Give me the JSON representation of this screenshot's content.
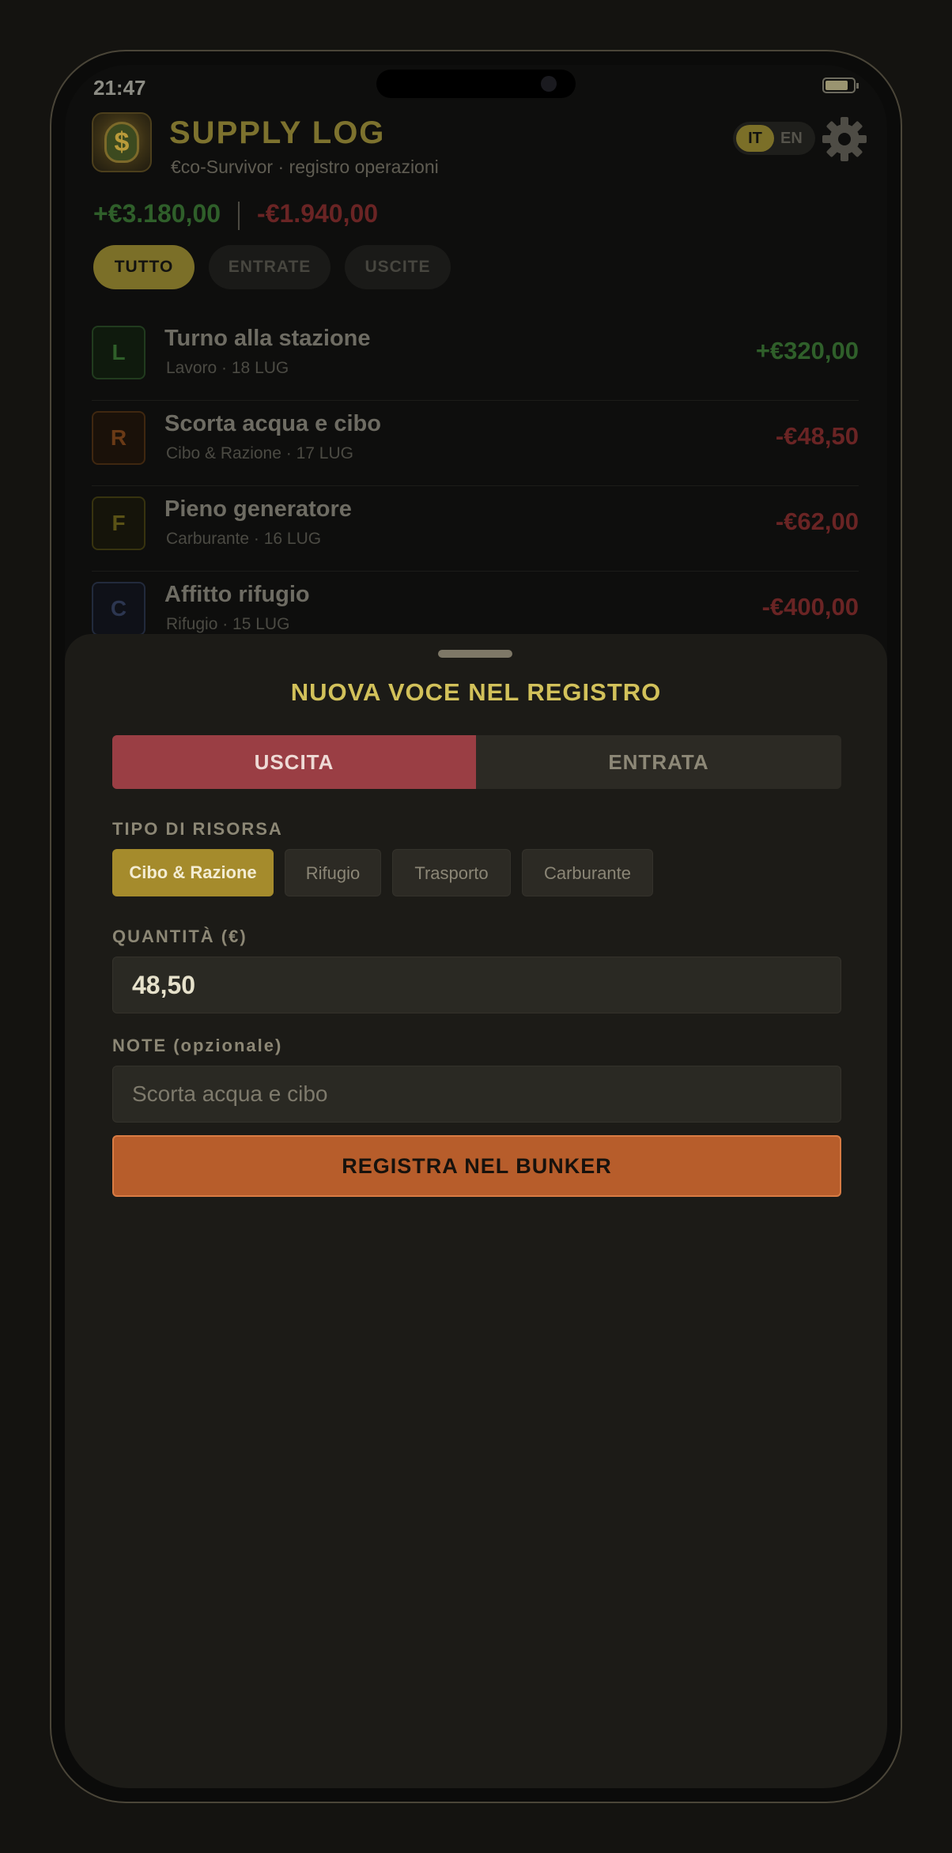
{
  "status_bar": {
    "time": "21:47"
  },
  "header": {
    "title": "SUPPLY LOG",
    "subtitle": "€co-Survivor · registro operazioni",
    "lang_active": "IT",
    "lang_other": "EN",
    "icon_glyph": "$"
  },
  "totals": {
    "income": "+€3.180,00",
    "expense": "-€1.940,00"
  },
  "filters": [
    {
      "label": "TUTTO",
      "active": true
    },
    {
      "label": "ENTRATE",
      "active": false
    },
    {
      "label": "USCITE",
      "active": false
    }
  ],
  "transactions": [
    {
      "letter": "L",
      "name": "Turno alla stazione",
      "meta": "Lavoro · 18 LUG",
      "amount": "+€320,00",
      "color": "#2f5f2a"
    },
    {
      "letter": "R",
      "name": "Scorta acqua e cibo",
      "meta": "Cibo & Razione · 17 LUG",
      "amount": "-€48,50",
      "color": "#6a3a16"
    },
    {
      "letter": "F",
      "name": "Pieno generatore",
      "meta": "Carburante · 16 LUG",
      "amount": "-€62,00",
      "color": "#5a5216"
    },
    {
      "letter": "C",
      "name": "Affitto rifugio",
      "meta": "Rifugio · 15 LUG",
      "amount": "-€400,00",
      "color": "#2c3650"
    }
  ],
  "sheet": {
    "title": "NUOVA VOCE NEL REGISTRO",
    "type_out": "USCITA",
    "type_in": "ENTRATA",
    "resource_label": "TIPO DI RISORSA",
    "resources": [
      "Cibo & Razione",
      "Rifugio",
      "Trasporto",
      "Carburante"
    ],
    "selected_resource": "Cibo & Razione",
    "amount_label": "QUANTITÀ (€)",
    "amount_value": "48,50",
    "note_label": "NOTE (opzionale)",
    "note_value": "Scorta acqua e cibo",
    "submit_label": "REGISTRA NEL BUNKER"
  },
  "colors": {
    "accent": "#d2c15a",
    "expense_red": "#9a3e44",
    "cta_orange": "#b75d2b",
    "resource_gold": "#a58b2c"
  }
}
